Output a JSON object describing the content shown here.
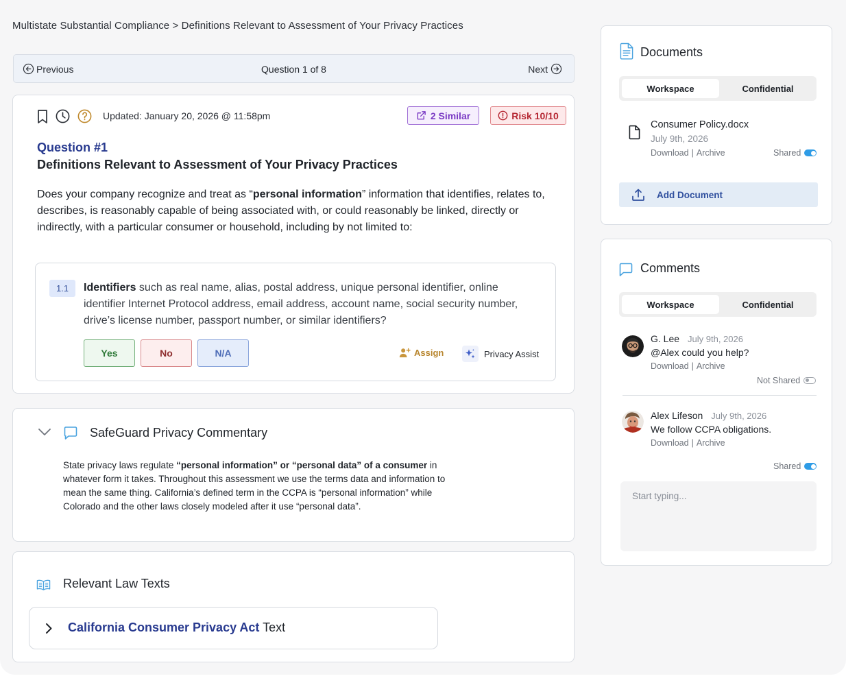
{
  "breadcrumb": "Multistate Substantial Compliance > Definitions Relevant to Assessment of Your Privacy Practices",
  "nav": {
    "previous": "Previous",
    "position": "Question 1 of 8",
    "next": "Next"
  },
  "question": {
    "updated": "Updated: January 20, 2026 @ 11:58pm",
    "similar": "2 Similar",
    "risk": "Risk 10/10",
    "number": "Question #1",
    "title": "Definitions Relevant to Assessment of Your Privacy Practices",
    "body_pre": "Does your company recognize and treat as “",
    "body_bold": "personal information",
    "body_post": "” information that identifies, relates to, describes, is reasonably capable of being associated with, or could reasonably be linked, directly or indirectly, with a particular consumer or household, including by not limited to:",
    "sub": {
      "number": "1.1",
      "bold": "Identifiers",
      "text": " such as real name, alias, postal address, unique personal identifier, online identifier Internet Protocol address, email address, account name, social security number, drive’s license number, passport number, or similar identifiers?",
      "answers": {
        "yes": "Yes",
        "no": "No",
        "na": "N/A"
      },
      "assign": "Assign",
      "privacy_assist": "Privacy Assist"
    }
  },
  "commentary": {
    "title": "SafeGuard Privacy Commentary",
    "body_pre": "State privacy laws regulate ",
    "body_bold": "“personal information” or “personal data” of a consumer",
    "body_post": " in whatever form it takes. Throughout this assessment we use the terms data and information to mean the same thing. California’s defined term in the CCPA is “personal information” while Colorado and the other laws closely modeled after it use “personal data”."
  },
  "law": {
    "title": "Relevant Law Texts",
    "item_bold": "California Consumer Privacy Act",
    "item_rest": " Text"
  },
  "documents": {
    "title": "Documents",
    "tabs": [
      "Workspace",
      "Confidential"
    ],
    "file": {
      "name": "Consumer Policy.docx",
      "date": "July 9th, 2026",
      "download": "Download",
      "archive": "Archive",
      "share": "Shared"
    },
    "add": "Add Document"
  },
  "comments": {
    "title": "Comments",
    "tabs": [
      "Workspace",
      "Confidential"
    ],
    "items": [
      {
        "author": "G. Lee",
        "date": "July 9th, 2026",
        "text": "@Alex could you help?",
        "download": "Download",
        "archive": "Archive",
        "share": "Not Shared"
      },
      {
        "author": "Alex Lifeson",
        "date": "July 9th, 2026",
        "text": "We follow CCPA obligations.",
        "download": "Download",
        "archive": "Archive",
        "share": "Shared"
      }
    ],
    "placeholder": "Start typing..."
  },
  "colors": {
    "accent_navy": "#283a8f",
    "similar_purple": "#7b3cc4",
    "risk_red": "#b52732",
    "toggle_blue": "#2f9ce6",
    "yes_green": "#2e7a38",
    "assign_gold": "#b8862f"
  },
  "icons": [
    "arrow-left-circle-icon",
    "arrow-right-circle-icon",
    "bookmark-icon",
    "clock-icon",
    "help-circle-icon",
    "external-link-icon",
    "alert-circle-icon",
    "user-plus-icon",
    "sparkles-icon",
    "chevron-down-icon",
    "chat-bubble-icon",
    "book-icon",
    "chevron-right-icon",
    "document-icon",
    "file-icon",
    "upload-icon"
  ]
}
